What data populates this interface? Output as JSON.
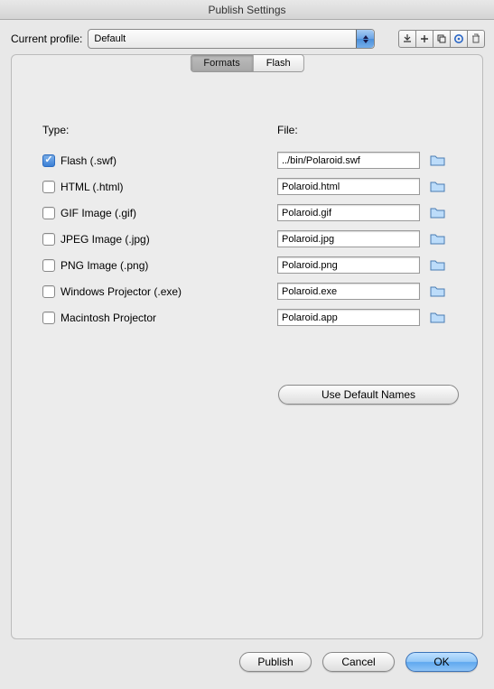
{
  "window": {
    "title": "Publish Settings"
  },
  "profile": {
    "label": "Current profile:",
    "selected": "Default"
  },
  "tabs": {
    "formats": "Formats",
    "flash": "Flash"
  },
  "headers": {
    "type": "Type:",
    "file": "File:"
  },
  "types": [
    {
      "label": "Flash (.swf)",
      "checked": true,
      "file": "../bin/Polaroid.swf"
    },
    {
      "label": "HTML (.html)",
      "checked": false,
      "file": "Polaroid.html"
    },
    {
      "label": "GIF Image (.gif)",
      "checked": false,
      "file": "Polaroid.gif"
    },
    {
      "label": "JPEG Image (.jpg)",
      "checked": false,
      "file": "Polaroid.jpg"
    },
    {
      "label": "PNG Image (.png)",
      "checked": false,
      "file": "Polaroid.png"
    },
    {
      "label": "Windows Projector (.exe)",
      "checked": false,
      "file": "Polaroid.exe"
    },
    {
      "label": "Macintosh Projector",
      "checked": false,
      "file": "Polaroid.app"
    }
  ],
  "buttons": {
    "use_defaults": "Use Default Names",
    "publish": "Publish",
    "cancel": "Cancel",
    "ok": "OK"
  }
}
